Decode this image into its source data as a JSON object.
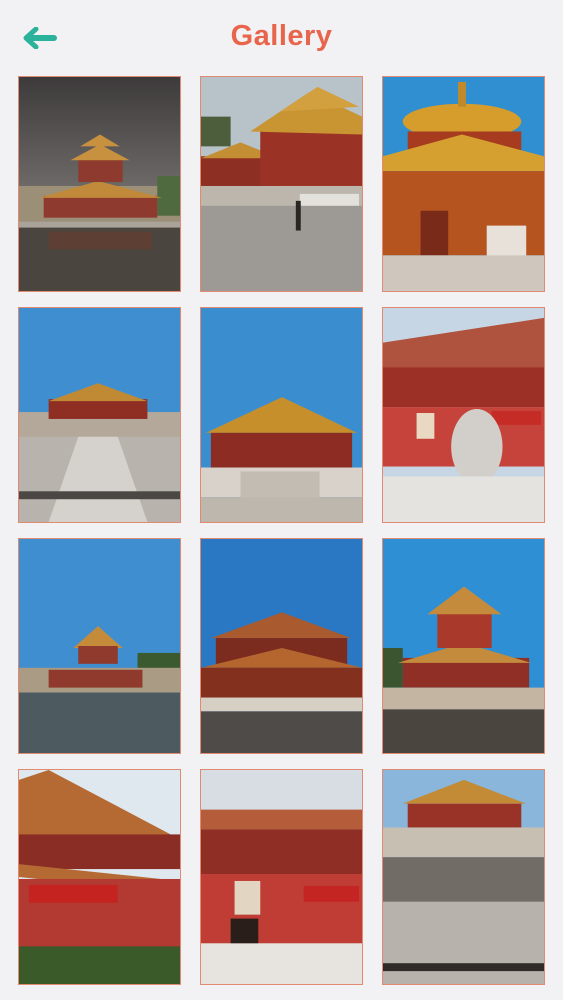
{
  "header": {
    "title": "Gallery",
    "back_icon": "arrow-left-icon"
  },
  "colors": {
    "background": "#f2f1f3",
    "title": "#e8654b",
    "back_icon": "#2bb29a",
    "tile_border": "#e08a72"
  },
  "gallery": {
    "photos": [
      {
        "id": "photo-1"
      },
      {
        "id": "photo-2"
      },
      {
        "id": "photo-3"
      },
      {
        "id": "photo-4"
      },
      {
        "id": "photo-5"
      },
      {
        "id": "photo-6"
      },
      {
        "id": "photo-7"
      },
      {
        "id": "photo-8"
      },
      {
        "id": "photo-9"
      },
      {
        "id": "photo-10"
      },
      {
        "id": "photo-11"
      },
      {
        "id": "photo-12"
      }
    ]
  }
}
